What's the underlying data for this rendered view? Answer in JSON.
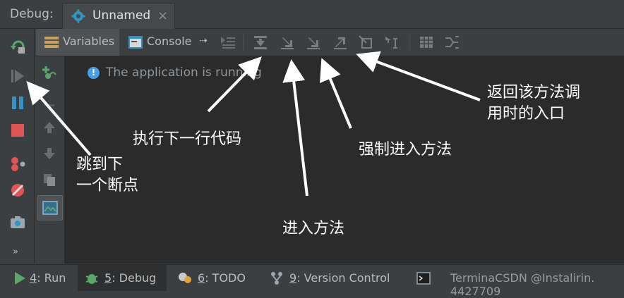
{
  "titlebar": {
    "debug_label": "Debug:",
    "session_name": "Unnamed",
    "close_glyph": "×"
  },
  "toolbar": {
    "variables_tab": "Variables",
    "console_tab": "Console",
    "pin_glyph": "⇢"
  },
  "left_toolbar": {
    "more_glyph": "»"
  },
  "content": {
    "message": "The application is running",
    "info_glyph": "!"
  },
  "statusbar": {
    "run": {
      "num": "4",
      "label": ": Run"
    },
    "debug": {
      "num": "5",
      "label": ": Debug"
    },
    "todo": {
      "num": "6",
      "label": ": TODO"
    },
    "vcs": {
      "num": "9",
      "label": ": Version Control"
    },
    "watermark": "TerminaCSDN @Instalirin. 4427709"
  },
  "annotations": {
    "next_breakpoint": [
      "跳到下",
      "一个断点"
    ],
    "step_over": "执行下一行代码",
    "step_into": "进入方法",
    "force_step_into": "强制进入方法",
    "step_out": [
      "返回该方法调",
      "用时的入口"
    ]
  },
  "colors": {
    "background": "#3c3f41",
    "content_bg": "#2b2b2b",
    "resume_green": "#59a869",
    "stop_red": "#e05555",
    "pause_blue": "#3592c4",
    "annotation": "#ffffff"
  }
}
